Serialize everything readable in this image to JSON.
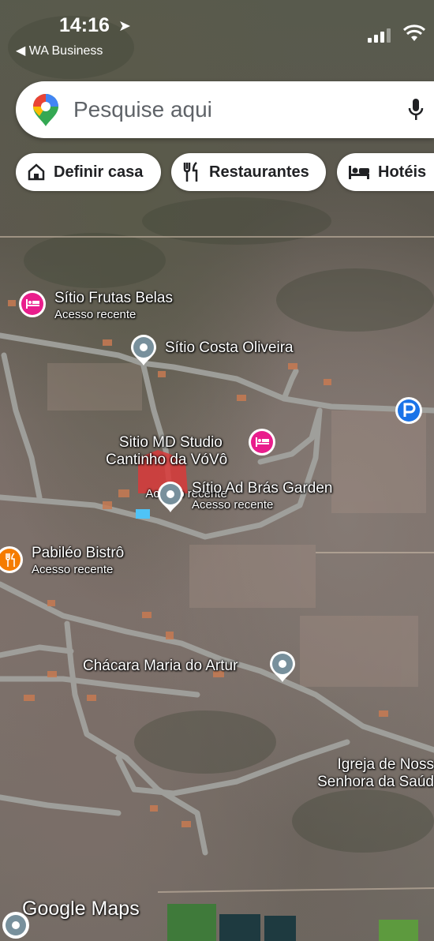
{
  "status_bar": {
    "time": "14:16",
    "back_app": "◀ WA Business"
  },
  "search": {
    "placeholder": "Pesquise aqui"
  },
  "chips": [
    {
      "label": "Definir casa",
      "icon": "home-icon"
    },
    {
      "label": "Restaurantes",
      "icon": "restaurant-icon"
    },
    {
      "label": "Hotéis",
      "icon": "hotel-icon"
    }
  ],
  "places": {
    "frutas_belas": {
      "name": "Sítio Frutas Belas",
      "sub": "Acesso recente",
      "icon": "hotel-icon"
    },
    "costa_oliveira": {
      "name": "Sítio Costa Oliveira",
      "icon": "pin-icon"
    },
    "md_studio": {
      "name": "Sitio MD Studio\nCantinho da VóVô",
      "sub": "Acesso recente",
      "icon": "hotel-icon"
    },
    "ad_bras": {
      "name": "Sítio Ad Brás Garden",
      "sub": "Acesso recente",
      "icon": "pin-icon"
    },
    "pabileo": {
      "name": "Pabiléo Bistrô",
      "sub": "Acesso recente",
      "icon": "restaurant-icon"
    },
    "chacara": {
      "name": "Chácara Maria do Artur",
      "icon": "pin-icon"
    },
    "igreja": {
      "name": "Igreja de Noss\nSenhora da Saúd",
      "icon": "church-icon"
    }
  },
  "branding": {
    "google_maps": "Google Maps"
  },
  "colors": {
    "hotel_pink": "#e91e8c",
    "pin_grey": "#78909c",
    "restaurant_orange": "#f57c00",
    "parking_blue": "#1a73e8",
    "road_grey": "#a3a4a0"
  }
}
